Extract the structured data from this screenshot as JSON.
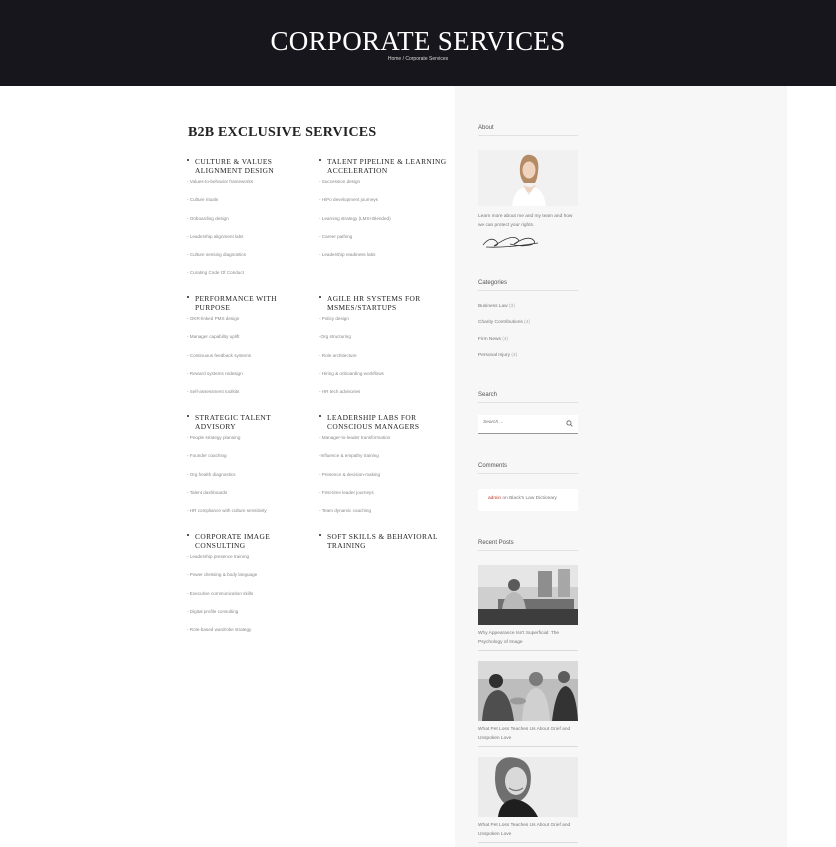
{
  "hero": {
    "title": "CORPORATE SERVICES",
    "crumb_home": "Home",
    "crumb_sep": "/",
    "crumb_current": "Corporate Services"
  },
  "main": {
    "title": "B2B EXCLUSIVE SERVICES",
    "services": [
      {
        "title": "CULTURE & VALUES ALIGNMENT DESIGN",
        "items": [
          "- Values-to-behavior frameworks",
          "- Culture rituals",
          "- Onboarding design",
          "- Leadership alignment labs",
          "- Culture sensing diagnostics",
          "- Curating Code Of Conduct"
        ]
      },
      {
        "title": "TALENT PIPELINE & LEARNING ACCELERATION",
        "items": [
          "- Succession design",
          "- HiPo development journeys",
          "- Learning strategy (LMS+Blended)",
          "- Career pathing",
          "- Leadership readiness labs"
        ]
      },
      {
        "title": "PERFORMANCE WITH PURPOSE",
        "items": [
          "- OKR-linked PMS design",
          "- Manager capability uplift",
          "- Continuous feedback systems",
          "- Reward systems redesign",
          "- Self-assessment toolkits"
        ]
      },
      {
        "title": "AGILE HR SYSTEMS FOR MSMES/STARTUPS",
        "items": [
          "- Policy design",
          "-Org structuring",
          "- Role architecture",
          "- Hiring & onboarding workflows",
          "- HR tech advisories"
        ]
      },
      {
        "title": "STRATEGIC TALENT ADVISORY",
        "items": [
          "- People strategy planning",
          "- Founder coaching",
          "- Org health diagnostics",
          "- Talent dashboards",
          "- HR compliance with culture sensitivity"
        ]
      },
      {
        "title": "LEADERSHIP LABS FOR CONSCIOUS MANAGERS",
        "items": [
          "- Manager-to-leader transformation",
          "-Influence & empathy training",
          "- Presence & decision-making",
          "- First-time leader journeys",
          "- Team dynamic coaching"
        ]
      },
      {
        "title": "CORPORATE IMAGE CONSULTING",
        "items": [
          "- Leadership presence training",
          "- Power dressing & body language",
          "- Executive communication skills",
          "- Digital profile consulting",
          "- Role-based wardrobe strategy"
        ]
      },
      {
        "title": "SOFT SKILLS & BEHAVIORAL TRAINING",
        "items": []
      }
    ]
  },
  "sidebar": {
    "about": {
      "title": "About",
      "text": "Learn more about me and my team and how we can protect your rights."
    },
    "categories": {
      "title": "Categories",
      "items": [
        {
          "label": "Business Law",
          "count": "(3)"
        },
        {
          "label": "Charity Contributions",
          "count": "(4)"
        },
        {
          "label": "Firm News",
          "count": "(4)"
        },
        {
          "label": "Personal Injury",
          "count": "(4)"
        }
      ]
    },
    "search": {
      "title": "Search",
      "placeholder": "Search ..."
    },
    "comments": {
      "title": "Comments",
      "author": "admin",
      "on": "on",
      "post": "Black's Law Dictionary"
    },
    "recent_posts": {
      "title": "Recent Posts",
      "posts": [
        "Why Appearance Isn't Superficial: The Psychology of Image",
        "What Pet Loss Teaches Us About Grief and Unspoken Love",
        "What Pet Loss Teaches Us About Grief and Unspoken Love"
      ]
    }
  },
  "colors": {
    "hero_bg": "#16161c",
    "sidebar_bg": "#f7f7f7",
    "comment_author": "#c0392b"
  }
}
